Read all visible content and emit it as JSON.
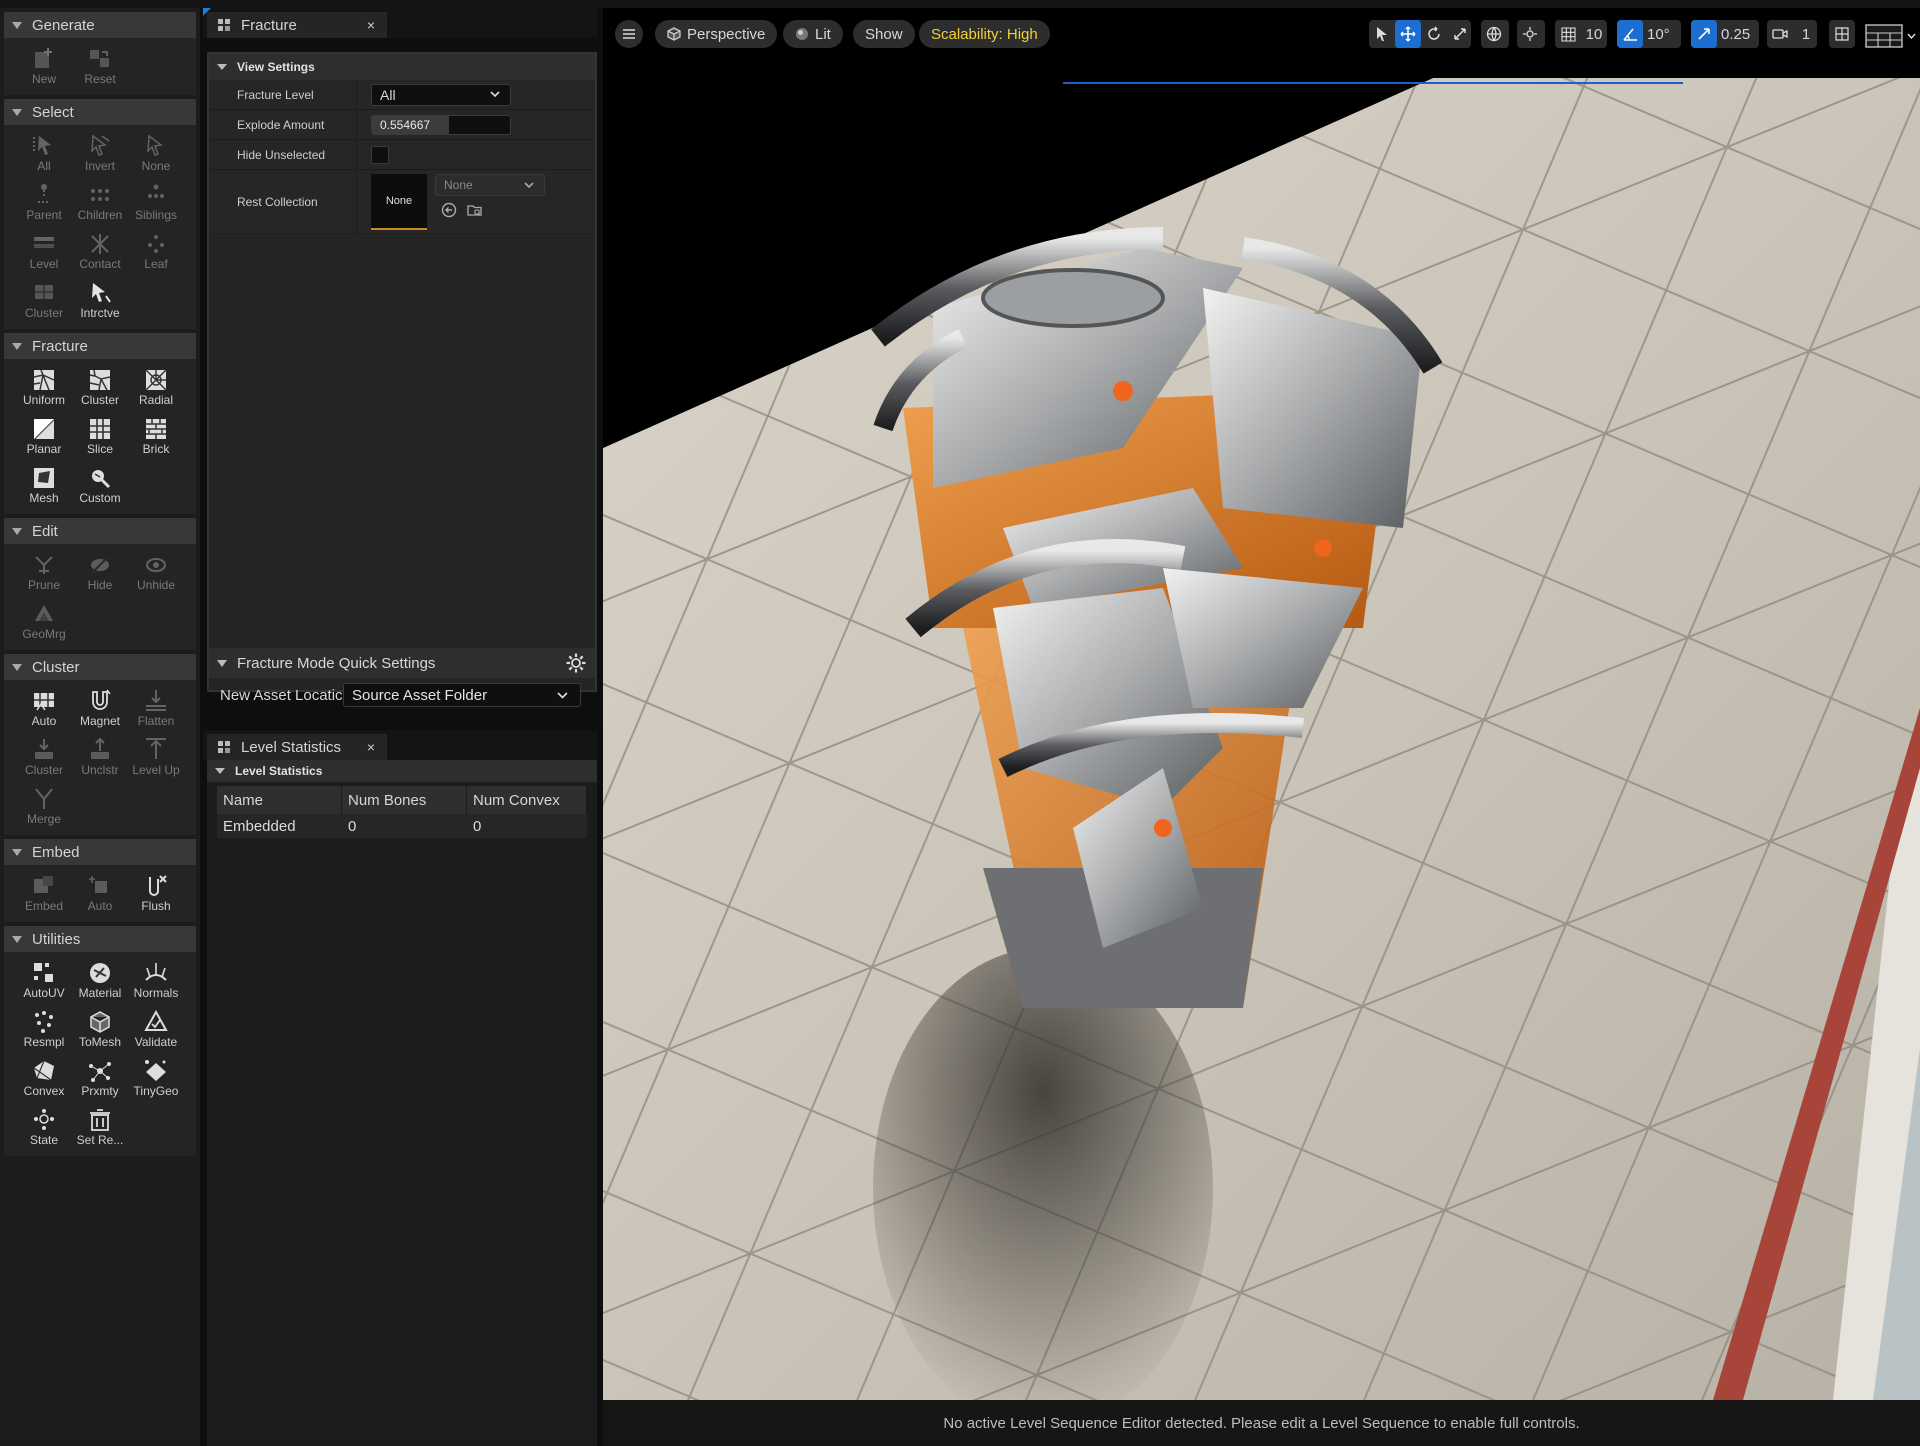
{
  "toolbar": {
    "sections": [
      {
        "title": "Generate",
        "tools": [
          {
            "label": "New",
            "icon": "new-asset-icon",
            "enabled": false
          },
          {
            "label": "Reset",
            "icon": "reset-icon",
            "enabled": false
          }
        ]
      },
      {
        "title": "Select",
        "tools": [
          {
            "label": "All",
            "icon": "select-all-icon",
            "enabled": false
          },
          {
            "label": "Invert",
            "icon": "invert-icon",
            "enabled": false
          },
          {
            "label": "None",
            "icon": "select-none-icon",
            "enabled": false
          },
          {
            "label": "Parent",
            "icon": "parent-icon",
            "enabled": false
          },
          {
            "label": "Children",
            "icon": "children-icon",
            "enabled": false
          },
          {
            "label": "Siblings",
            "icon": "siblings-icon",
            "enabled": false
          },
          {
            "label": "Level",
            "icon": "level-icon",
            "enabled": false
          },
          {
            "label": "Contact",
            "icon": "contact-icon",
            "enabled": false
          },
          {
            "label": "Leaf",
            "icon": "leaf-icon",
            "enabled": false
          },
          {
            "label": "Cluster",
            "icon": "cluster-select-icon",
            "enabled": false
          },
          {
            "label": "Intrctve",
            "icon": "interactive-icon",
            "enabled": true
          }
        ]
      },
      {
        "title": "Fracture",
        "tools": [
          {
            "label": "Uniform",
            "icon": "uniform-icon",
            "enabled": true
          },
          {
            "label": "Cluster",
            "icon": "cluster-fracture-icon",
            "enabled": true
          },
          {
            "label": "Radial",
            "icon": "radial-icon",
            "enabled": true
          },
          {
            "label": "Planar",
            "icon": "planar-icon",
            "enabled": true
          },
          {
            "label": "Slice",
            "icon": "slice-icon",
            "enabled": true
          },
          {
            "label": "Brick",
            "icon": "brick-icon",
            "enabled": true
          },
          {
            "label": "Mesh",
            "icon": "mesh-icon",
            "enabled": true
          },
          {
            "label": "Custom",
            "icon": "custom-icon",
            "enabled": true
          }
        ]
      },
      {
        "title": "Edit",
        "tools": [
          {
            "label": "Prune",
            "icon": "prune-icon",
            "enabled": false
          },
          {
            "label": "Hide",
            "icon": "hide-icon",
            "enabled": false
          },
          {
            "label": "Unhide",
            "icon": "unhide-icon",
            "enabled": false
          },
          {
            "label": "GeoMrg",
            "icon": "geomerge-icon",
            "enabled": false
          }
        ]
      },
      {
        "title": "Cluster",
        "tools": [
          {
            "label": "Auto",
            "icon": "auto-cluster-icon",
            "enabled": true
          },
          {
            "label": "Magnet",
            "icon": "magnet-icon",
            "enabled": true
          },
          {
            "label": "Flatten",
            "icon": "flatten-icon",
            "enabled": false
          },
          {
            "label": "Cluster",
            "icon": "cluster-icon",
            "enabled": false
          },
          {
            "label": "Unclstr",
            "icon": "uncluster-icon",
            "enabled": false
          },
          {
            "label": "Level Up",
            "icon": "level-up-icon",
            "enabled": false
          },
          {
            "label": "Merge",
            "icon": "merge-icon",
            "enabled": false
          }
        ]
      },
      {
        "title": "Embed",
        "tools": [
          {
            "label": "Embed",
            "icon": "embed-icon",
            "enabled": false
          },
          {
            "label": "Auto",
            "icon": "auto-embed-icon",
            "enabled": false
          },
          {
            "label": "Flush",
            "icon": "flush-icon",
            "enabled": true
          }
        ]
      },
      {
        "title": "Utilities",
        "tools": [
          {
            "label": "AutoUV",
            "icon": "autouv-icon",
            "enabled": true
          },
          {
            "label": "Material",
            "icon": "material-icon",
            "enabled": true
          },
          {
            "label": "Normals",
            "icon": "normals-icon",
            "enabled": true
          },
          {
            "label": "Resmpl",
            "icon": "resample-icon",
            "enabled": true
          },
          {
            "label": "ToMesh",
            "icon": "tomesh-icon",
            "enabled": true
          },
          {
            "label": "Validate",
            "icon": "validate-icon",
            "enabled": true
          },
          {
            "label": "Convex",
            "icon": "convex-icon",
            "enabled": true
          },
          {
            "label": "Prxmty",
            "icon": "proximity-icon",
            "enabled": true
          },
          {
            "label": "TinyGeo",
            "icon": "tinygeo-icon",
            "enabled": true
          },
          {
            "label": "State",
            "icon": "state-icon",
            "enabled": true
          },
          {
            "label": "Set Re...",
            "icon": "set-remove-icon",
            "enabled": true
          }
        ]
      }
    ]
  },
  "fracture_panel": {
    "tab_title": "Fracture",
    "close_glyph": "×",
    "view_settings_title": "View Settings",
    "fracture_level_label": "Fracture Level",
    "fracture_level_value": "All",
    "explode_amount_label": "Explode Amount",
    "explode_amount_value": "0.554667",
    "explode_amount_fraction": 0.554667,
    "hide_unselected_label": "Hide Unselected",
    "hide_unselected_checked": false,
    "rest_collection_label": "Rest Collection",
    "rest_collection_thumb": "None",
    "rest_collection_value": "None",
    "quick_settings_title": "Fracture Mode Quick Settings",
    "new_asset_location_label": "New Asset Locatic",
    "new_asset_location_value": "Source Asset Folder"
  },
  "level_statistics": {
    "tab_title": "Level Statistics",
    "close_glyph": "×",
    "section_title": "Level Statistics",
    "columns": [
      "Name",
      "Num Bones",
      "Num Convex"
    ],
    "rows": [
      [
        "Embedded",
        "0",
        "0"
      ]
    ]
  },
  "viewport": {
    "view_mode": "Perspective",
    "lighting": "Lit",
    "show": "Show",
    "scalability": "Scalability: High",
    "grid_snap": "10",
    "rotation_snap": "10°",
    "scale_snap": "0.25",
    "camera_speed": "1",
    "status_message": "No active Level Sequence Editor detected. Please edit a Level Sequence to enable full controls."
  },
  "colors": {
    "accent_blue": "#1c6fd1",
    "scalability_yellow": "#f1d13a",
    "thumb_underline": "#c88b24"
  }
}
